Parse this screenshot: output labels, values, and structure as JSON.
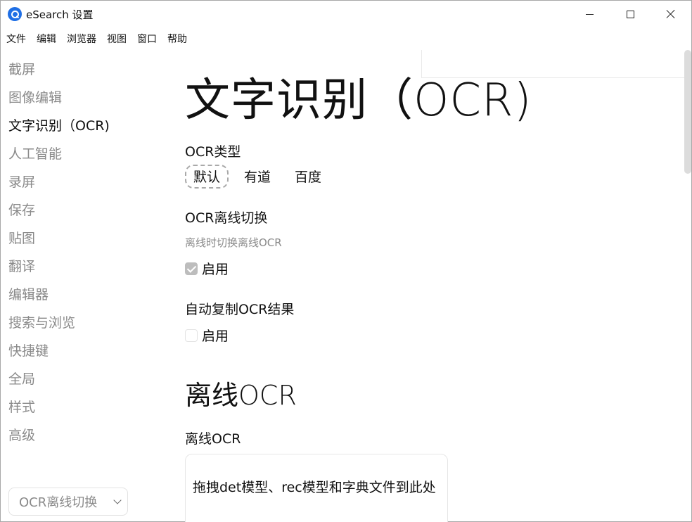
{
  "window": {
    "title": "eSearch 设置"
  },
  "menu": {
    "items": [
      "文件",
      "编辑",
      "浏览器",
      "视图",
      "窗口",
      "帮助"
    ]
  },
  "sidebar": {
    "items": [
      {
        "label": "截屏",
        "active": false
      },
      {
        "label": "图像编辑",
        "active": false
      },
      {
        "label": "文字识别（OCR)",
        "active": true
      },
      {
        "label": "人工智能",
        "active": false
      },
      {
        "label": "录屏",
        "active": false
      },
      {
        "label": "保存",
        "active": false
      },
      {
        "label": "贴图",
        "active": false
      },
      {
        "label": "翻译",
        "active": false
      },
      {
        "label": "编辑器",
        "active": false
      },
      {
        "label": "搜索与浏览",
        "active": false
      },
      {
        "label": "快捷键",
        "active": false
      },
      {
        "label": "全局",
        "active": false
      },
      {
        "label": "样式",
        "active": false
      },
      {
        "label": "高级",
        "active": false
      }
    ],
    "section_select": {
      "value": "OCR离线切换"
    }
  },
  "content": {
    "page_title": "文字识别（OCR)",
    "ocr_type": {
      "label": "OCR类型",
      "options": [
        "默认",
        "有道",
        "百度"
      ],
      "selected": "默认"
    },
    "offline_switch": {
      "label": "OCR离线切换",
      "description": "离线时切换离线OCR",
      "checkbox_label": "启用",
      "checked": true
    },
    "auto_copy": {
      "label": "自动复制OCR结果",
      "checkbox_label": "启用",
      "checked": false
    },
    "offline_section": {
      "title": "离线OCR",
      "label": "离线OCR",
      "drop_text": "拖拽det模型、rec模型和字典文件到此处"
    }
  },
  "colors": {
    "muted_text": "#8a8a8a",
    "active_text": "#111111",
    "app_icon": "#1f6fe5",
    "checkbox_checked": "#bdbdbd"
  }
}
